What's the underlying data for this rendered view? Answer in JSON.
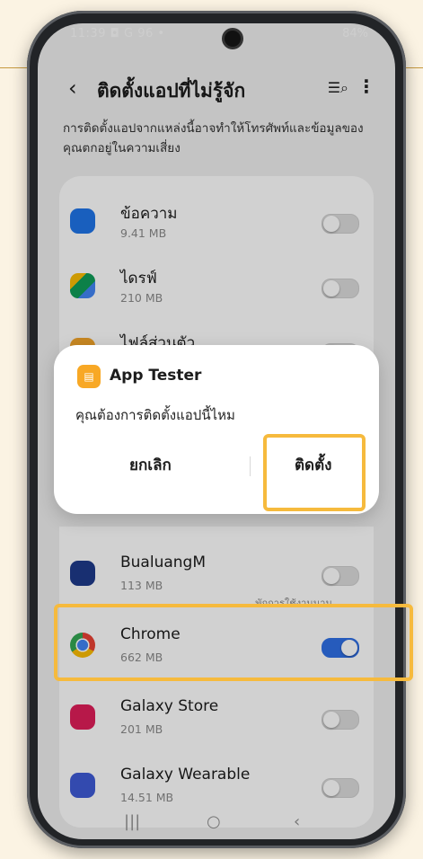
{
  "status_bar": {
    "time": "11:39",
    "left_extra": "◘ G 96 •",
    "battery": "84%"
  },
  "header": {
    "title": "ติดตั้งแอปที่ไม่รู้จัก"
  },
  "description": "การติดตั้งแอปจากแหล่งนี้อาจทำให้โทรศัพท์และข้อมูลของคุณตกอยู่ในความเสี่ยง",
  "apps_top": [
    {
      "name": "ข้อความ",
      "size": "9.41 MB",
      "icon": "messages-icon",
      "color": "#1f74e8",
      "enabled": false
    },
    {
      "name": "ไดรฟ์",
      "size": "210 MB",
      "icon": "drive-icon",
      "color": "#0f9d58",
      "enabled": false
    },
    {
      "name": "ไฟล์ส่วนตัว",
      "size": "",
      "icon": "files-icon",
      "color": "#f3a52a",
      "enabled": false
    }
  ],
  "dialog": {
    "app_name": "App Tester",
    "message": "คุณต้องการติดตั้งแอปนี้ไหม",
    "cancel": "ยกเลิก",
    "install": "ติดตั้ง"
  },
  "apps_bottom": [
    {
      "name": "BualuangM",
      "size": "113 MB",
      "icon": "bualuang-icon",
      "color": "#1e3a8a",
      "enabled": false,
      "note": "พักการใช้งานนาน"
    },
    {
      "name": "Chrome",
      "size": "662 MB",
      "icon": "chrome-icon",
      "color": "#ea4335",
      "enabled": true
    },
    {
      "name": "Galaxy Store",
      "size": "201 MB",
      "icon": "galaxy-store-icon",
      "color": "#e01e5a",
      "enabled": false
    },
    {
      "name": "Galaxy Wearable",
      "size": "14.51 MB",
      "icon": "wear-icon",
      "color": "#3f5bd6",
      "enabled": false
    }
  ],
  "colors": {
    "highlight": "#f6ba3d",
    "toggle_on": "#2f6fe6"
  }
}
